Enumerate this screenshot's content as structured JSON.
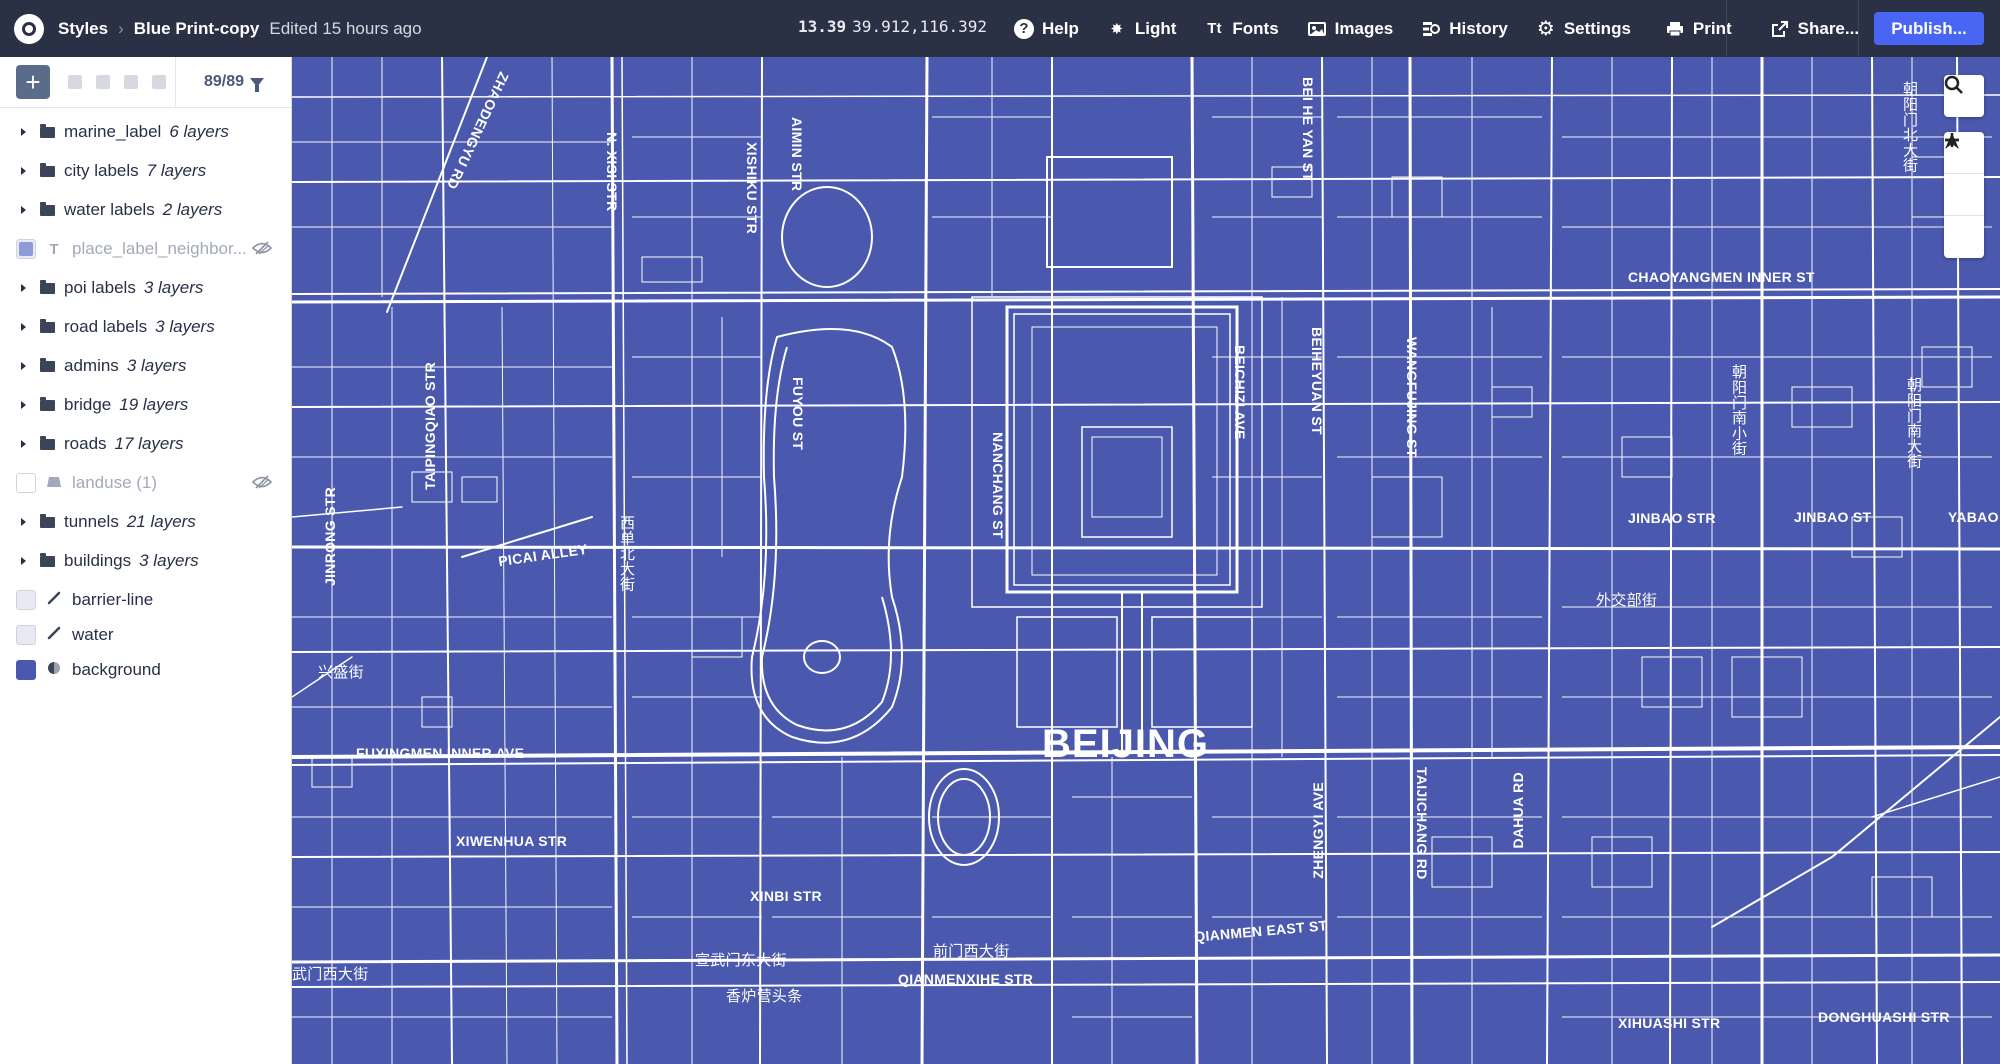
{
  "topbar": {
    "app_label": "Styles",
    "style_name": "Blue Print-copy",
    "edited": "Edited 15 hours ago",
    "zoom": "13.39",
    "coordinates": "39.912,116.392",
    "items": [
      {
        "label": "Help",
        "icon": "help-icon"
      },
      {
        "label": "Light",
        "icon": "sun-icon"
      },
      {
        "label": "Fonts",
        "icon": "fonts-icon"
      },
      {
        "label": "Images",
        "icon": "image-icon"
      },
      {
        "label": "History",
        "icon": "history-icon"
      },
      {
        "label": "Settings",
        "icon": "gear-icon"
      },
      {
        "label": "Print",
        "icon": "print-icon"
      },
      {
        "label": "Share...",
        "icon": "share-icon"
      }
    ],
    "publish": "Publish..."
  },
  "sidebar": {
    "layer_count": "89/89",
    "layers": [
      {
        "name": "marine_label",
        "count": "6 layers",
        "type": "group"
      },
      {
        "name": "city labels",
        "count": "7 layers",
        "type": "group"
      },
      {
        "name": "water labels",
        "count": "2 layers",
        "type": "group"
      },
      {
        "name": "place_label_neighbor...",
        "count": "",
        "type": "symbol",
        "hidden": true
      },
      {
        "name": "poi labels",
        "count": "3 layers",
        "type": "group"
      },
      {
        "name": "road labels",
        "count": "3 layers",
        "type": "group"
      },
      {
        "name": "admins",
        "count": "3 layers",
        "type": "group"
      },
      {
        "name": "bridge",
        "count": "19 layers",
        "type": "group"
      },
      {
        "name": "roads",
        "count": "17 layers",
        "type": "group"
      },
      {
        "name": "landuse (1)",
        "count": "",
        "type": "fill",
        "hidden": true
      },
      {
        "name": "tunnels",
        "count": "21 layers",
        "type": "group"
      },
      {
        "name": "buildings",
        "count": "3 layers",
        "type": "group"
      },
      {
        "name": "barrier-line",
        "count": "",
        "type": "line"
      },
      {
        "name": "water",
        "count": "",
        "type": "line"
      },
      {
        "name": "background",
        "count": "",
        "type": "background"
      }
    ]
  },
  "map": {
    "city": "BEIJING",
    "labels": {
      "zhaodengyu": "ZHAODENGYU RD",
      "nxisi": "N. XISI STR",
      "xishiku": "XISHIKU STR",
      "aimin": "AIMIN STR",
      "beiheyan": "BEI HE YAN ST",
      "chaoyangmen": "CHAOYANGMEN INNER ST",
      "taipingqiao": "TAIPINGQIAO STR",
      "fuyou": "FUYOU ST",
      "nanchang": "NANCHANG ST",
      "beichizi": "BEICHIZI AVE",
      "beiheyuan": "BEIHEYUAN ST",
      "wangfujing": "WANGFUJING ST",
      "jinrong": "JINRONG STR",
      "picai": "PICAI ALLEY",
      "jinbao1": "JINBAO STR",
      "jinbao2": "JINBAO ST",
      "yabao": "YABAO",
      "fuxingmen": "FUXINGMEN INNER AVE",
      "xiwenhua": "XIWENHUA STR",
      "xinbi": "XINBI STR",
      "zhengyi": "ZHENGYI AVE",
      "taijichang": "TAIJICHANG RD",
      "dahua": "DAHUA RD",
      "qianmen_east": "QIANMEN EAST ST",
      "qianmenxihe": "QIANMENXIHE STR",
      "xihuashi": "XIHUASHI STR",
      "donghuashi": "DONGHUASHI STR",
      "zh_xidan": "西单北大街",
      "zh_xingsheng": "兴盛街",
      "zh_waijiaobu": "外交部街",
      "zh_xuanwu": "宣武门东大街",
      "zh_qianmen_west": "前门西大街",
      "zh_xianglu": "香炉营头条",
      "zh_chaoyang_north": "朝阳门北大街",
      "zh_chaoyang_south": "朝阳门南小街",
      "zh_chaoyang_nan2": "朝阳门南大街",
      "zh_xuanwumen_west": "武门西大街"
    }
  },
  "colors": {
    "map_bg": "#4a58ad",
    "topbar_bg": "#2a3144",
    "publish": "#4965f3",
    "road": "#ffffff"
  }
}
